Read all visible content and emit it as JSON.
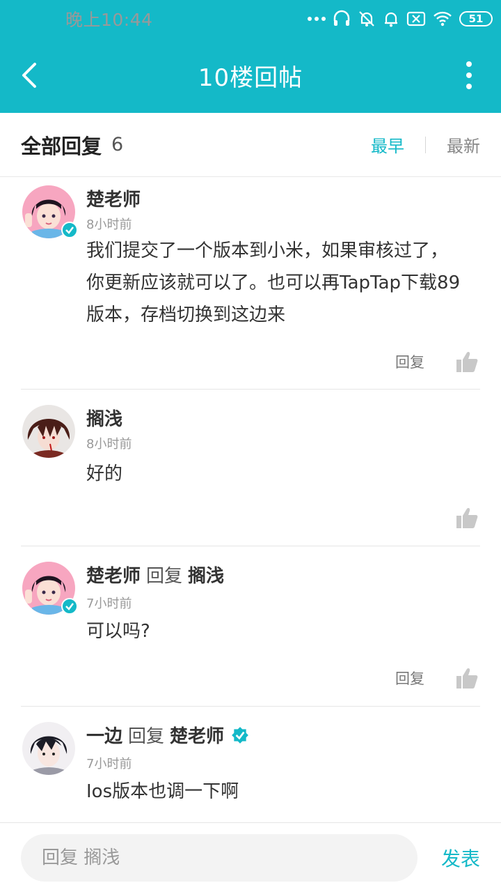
{
  "statusbar": {
    "time": "晚上10:44",
    "battery": "51",
    "icons": [
      "more-dots-icon",
      "headset-icon",
      "mute-bell-icon",
      "bell-icon",
      "sim-x-icon",
      "wifi-icon",
      "battery-icon"
    ]
  },
  "navbar": {
    "title": "10楼回帖",
    "back_icon": "back-arrow-icon",
    "more_icon": "more-vertical-icon"
  },
  "header": {
    "title": "全部回复",
    "count": "6",
    "sort_earliest": "最早",
    "sort_latest": "最新"
  },
  "comments": [
    {
      "author": "楚老师",
      "verified": true,
      "time": "8小时前",
      "lines": [
        "我们提交了一个版本到小米，如果审核过了，",
        "你更新应该就可以了。也可以再TapTap下载89",
        "版本，存档切换到这边来"
      ],
      "reply_label": "回复"
    },
    {
      "author": "搁浅",
      "verified": false,
      "time": "8小时前",
      "lines": [
        "好的"
      ],
      "reply_label": ""
    },
    {
      "author": "楚老师",
      "reply_word": "回复",
      "target": "搁浅",
      "verified": true,
      "time": "7小时前",
      "lines": [
        "可以吗?"
      ],
      "reply_label": "回复"
    },
    {
      "author": "一边",
      "reply_word": "回复",
      "target": "楚老师",
      "target_verified": true,
      "time": "7小时前",
      "lines": [
        "Ios版本也调一下啊"
      ]
    }
  ],
  "bottombar": {
    "placeholder": "回复 搁浅",
    "send_label": "发表"
  },
  "colors": {
    "accent": "#14b9c8"
  }
}
